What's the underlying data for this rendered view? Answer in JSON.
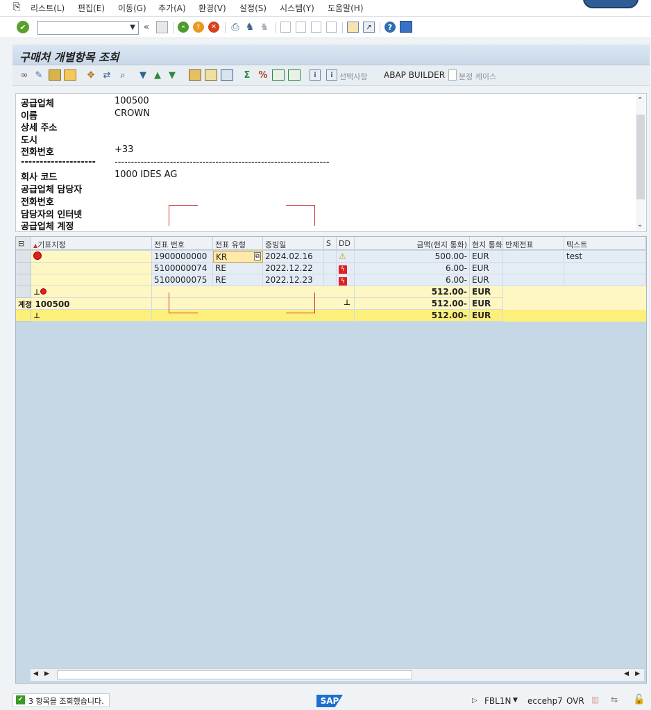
{
  "menu": [
    {
      "label": "리스트(L)"
    },
    {
      "label": "편집(E)"
    },
    {
      "label": "이동(G)"
    },
    {
      "label": "추가(A)"
    },
    {
      "label": "환경(V)"
    },
    {
      "label": "설정(S)"
    },
    {
      "label": "시스템(Y)"
    },
    {
      "label": "도움말(H)"
    }
  ],
  "command_field": {
    "value": ""
  },
  "title": "구매처 개별항목 조회",
  "app_toolbar": {
    "selection_label": "선택사항",
    "abap_builder": "ABAP BUILDER",
    "split_case": "분정 케이스"
  },
  "header": {
    "rows": [
      {
        "label": "공급업체",
        "value": "100500"
      },
      {
        "label": "이름",
        "value": "CROWN"
      },
      {
        "label": "상세 주소",
        "value": ""
      },
      {
        "label": "도시",
        "value": ""
      },
      {
        "label": "전화번호",
        "value": "+33"
      },
      {
        "label": "--------------------",
        "value": "------------------------------------------------------------------"
      },
      {
        "label": "회사 코드",
        "value": "1000 IDES AG"
      },
      {
        "label": "공급업체 담당자",
        "value": ""
      },
      {
        "label": "전화번호",
        "value": ""
      },
      {
        "label": "담당자의 인터넷",
        "value": ""
      },
      {
        "label": "공급업체 계정",
        "value": ""
      }
    ]
  },
  "grid": {
    "columns": [
      "기표지정",
      "전표 번호",
      "전표 유형",
      "증빙일",
      "S",
      "DD",
      "금액(현지 통화)",
      "현지 통화",
      "반제전표",
      "텍스트"
    ],
    "rows": [
      {
        "doc_no": "1900000000",
        "doc_type": "KR",
        "date": "2024.02.16",
        "amount": "500.00-",
        "currency": "EUR",
        "text": "test"
      },
      {
        "doc_no": "5100000074",
        "doc_type": "RE",
        "date": "2022.12.22",
        "amount": "6.00-",
        "currency": "EUR",
        "text": ""
      },
      {
        "doc_no": "5100000075",
        "doc_type": "RE",
        "date": "2022.12.23",
        "amount": "6.00-",
        "currency": "EUR",
        "text": ""
      }
    ],
    "subtotal1": {
      "amount": "512.00-",
      "currency": "EUR"
    },
    "account_label": "계정",
    "account_value": "100500",
    "subtotal2": {
      "amount": "512.00-",
      "currency": "EUR"
    },
    "total": {
      "amount": "512.00-",
      "currency": "EUR"
    }
  },
  "status": {
    "message": "3 항목을 조회했습니다.",
    "logo": "SAP",
    "tcode": "FBL1N",
    "system": "ecc​ehp7",
    "mode": "OVR"
  },
  "colors": {
    "title_bg": "#c8d8e8",
    "grid_bg": "#c6d7e6",
    "subtotal_bg": "#fff7c2",
    "total_bg": "#fdf07a",
    "row_bg": "#e4edf6",
    "annot": "#d03030"
  }
}
